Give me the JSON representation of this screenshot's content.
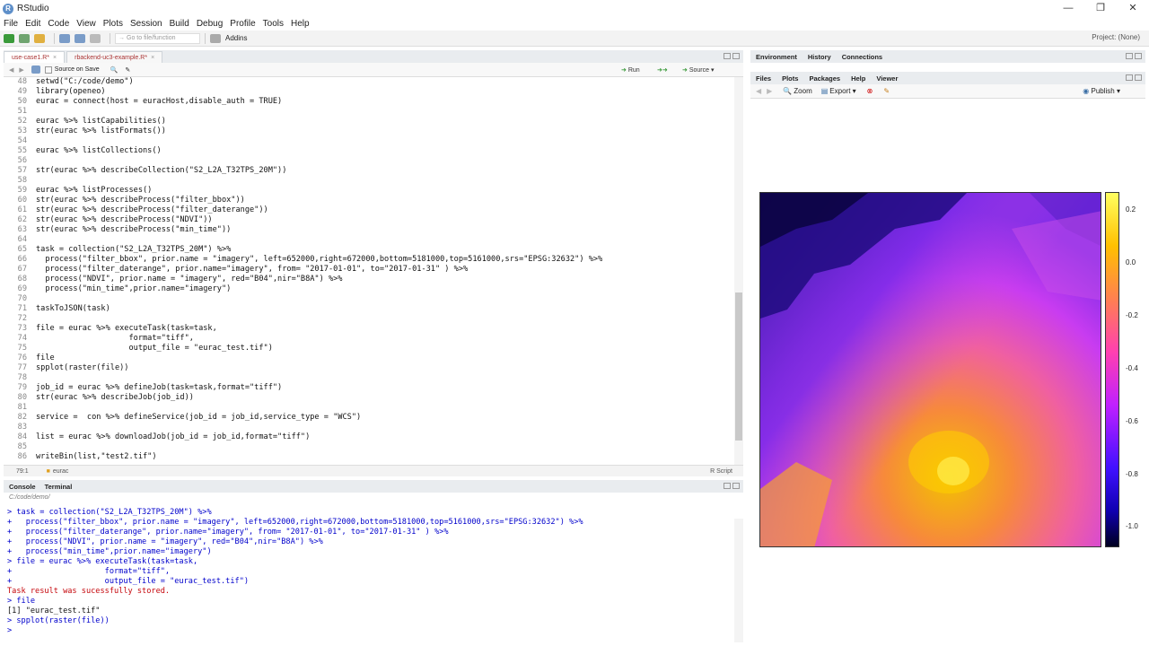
{
  "window": {
    "title": "RStudio",
    "controls": [
      "—",
      "❐",
      "✕"
    ]
  },
  "menu": [
    "File",
    "Edit",
    "Code",
    "View",
    "Plots",
    "Session",
    "Build",
    "Debug",
    "Profile",
    "Tools",
    "Help"
  ],
  "toolbar": {
    "goto_placeholder": "Go to file/function",
    "addins": "Addins",
    "project": "Project: (None)"
  },
  "editor": {
    "tabs": [
      "use-case1.R*",
      "rbackend-uc3-example.R*"
    ],
    "source_on_save": "Source on Save",
    "run": "Run",
    "source": "Source",
    "line_numbers": [
      "48",
      "49",
      "50",
      "51",
      "52",
      "53",
      "54",
      "55",
      "56",
      "57",
      "58",
      "59",
      "60",
      "61",
      "62",
      "63",
      "64",
      "65",
      "66",
      "67",
      "68",
      "69",
      "70",
      "71",
      "72",
      "73",
      "74",
      "75",
      "76",
      "77",
      "78",
      "79",
      "80",
      "81",
      "82",
      "83",
      "84",
      "85",
      "86"
    ],
    "lines": [
      "setwd(\"C:/code/demo\")",
      "library(openeo)",
      "eurac = connect(host = euracHost,disable_auth = TRUE)",
      "",
      "eurac %>% listCapabilities()",
      "str(eurac %>% listFormats())",
      "",
      "eurac %>% listCollections()",
      "",
      "str(eurac %>% describeCollection(\"S2_L2A_T32TPS_20M\"))",
      "",
      "eurac %>% listProcesses()",
      "str(eurac %>% describeProcess(\"filter_bbox\"))",
      "str(eurac %>% describeProcess(\"filter_daterange\"))",
      "str(eurac %>% describeProcess(\"NDVI\"))",
      "str(eurac %>% describeProcess(\"min_time\"))",
      "",
      "task = collection(\"S2_L2A_T32TPS_20M\") %>%",
      "  process(\"filter_bbox\", prior.name = \"imagery\", left=652000,right=672000,bottom=5181000,top=5161000,srs=\"EPSG:32632\") %>%",
      "  process(\"filter_daterange\", prior.name=\"imagery\", from= \"2017-01-01\", to=\"2017-01-31\" ) %>%",
      "  process(\"NDVI\", prior.name = \"imagery\", red=\"B04\",nir=\"B8A\") %>%",
      "  process(\"min_time\",prior.name=\"imagery\")",
      "",
      "taskToJSON(task)",
      "",
      "file = eurac %>% executeTask(task=task,",
      "                    format=\"tiff\",",
      "                    output_file = \"eurac_test.tif\")",
      "file",
      "spplot(raster(file))",
      "",
      "job_id = eurac %>% defineJob(task=task,format=\"tiff\")",
      "str(eurac %>% describeJob(job_id))",
      "",
      "service =  con %>% defineService(job_id = job_id,service_type = \"WCS\")",
      "",
      "list = eurac %>% downloadJob(job_id = job_id,format=\"tiff\")",
      "",
      "writeBin(list,\"test2.tif\")"
    ],
    "status_pos": "79:1",
    "status_scope": "eurac",
    "status_type": "R Script"
  },
  "console": {
    "tabs": [
      "Console",
      "Terminal"
    ],
    "path": "C:/code/demo/",
    "lines": [
      {
        "text": "> task = collection(\"S2_L2A_T32TPS_20M\") %>%",
        "kind": "cmd"
      },
      {
        "text": "+   process(\"filter_bbox\", prior.name = \"imagery\", left=652000,right=672000,bottom=5181000,top=5161000,srs=\"EPSG:32632\") %>%",
        "kind": "cmd"
      },
      {
        "text": "+   process(\"filter_daterange\", prior.name=\"imagery\", from= \"2017-01-01\", to=\"2017-01-31\" ) %>%",
        "kind": "cmd"
      },
      {
        "text": "+   process(\"NDVI\", prior.name = \"imagery\", red=\"B04\",nir=\"B8A\") %>%",
        "kind": "cmd"
      },
      {
        "text": "+   process(\"min_time\",prior.name=\"imagery\")",
        "kind": "cmd"
      },
      {
        "text": "> file = eurac %>% executeTask(task=task,",
        "kind": "cmd"
      },
      {
        "text": "+                    format=\"tiff\",",
        "kind": "cmd"
      },
      {
        "text": "+                    output_file = \"eurac_test.tif\")",
        "kind": "cmd"
      },
      {
        "text": "Task result was sucessfully stored.",
        "kind": "err"
      },
      {
        "text": "> file",
        "kind": "cmd"
      },
      {
        "text": "[1] \"eurac_test.tif\"",
        "kind": "out"
      },
      {
        "text": "> spplot(raster(file))",
        "kind": "cmd"
      },
      {
        "text": ">",
        "kind": "cmd"
      }
    ]
  },
  "env_tabs": [
    "Environment",
    "History",
    "Connections"
  ],
  "files_tabs": [
    "Files",
    "Plots",
    "Packages",
    "Help",
    "Viewer"
  ],
  "plot_toolbar": {
    "zoom": "Zoom",
    "export": "Export",
    "publish": "Publish"
  },
  "colorbar_ticks": [
    "0.2",
    "0.0",
    "-0.2",
    "-0.4",
    "-0.6",
    "-0.8",
    "-1.0"
  ],
  "colors": {
    "accent": "#5e8fc9",
    "string": "#0a7f28",
    "error": "#c5060b"
  }
}
